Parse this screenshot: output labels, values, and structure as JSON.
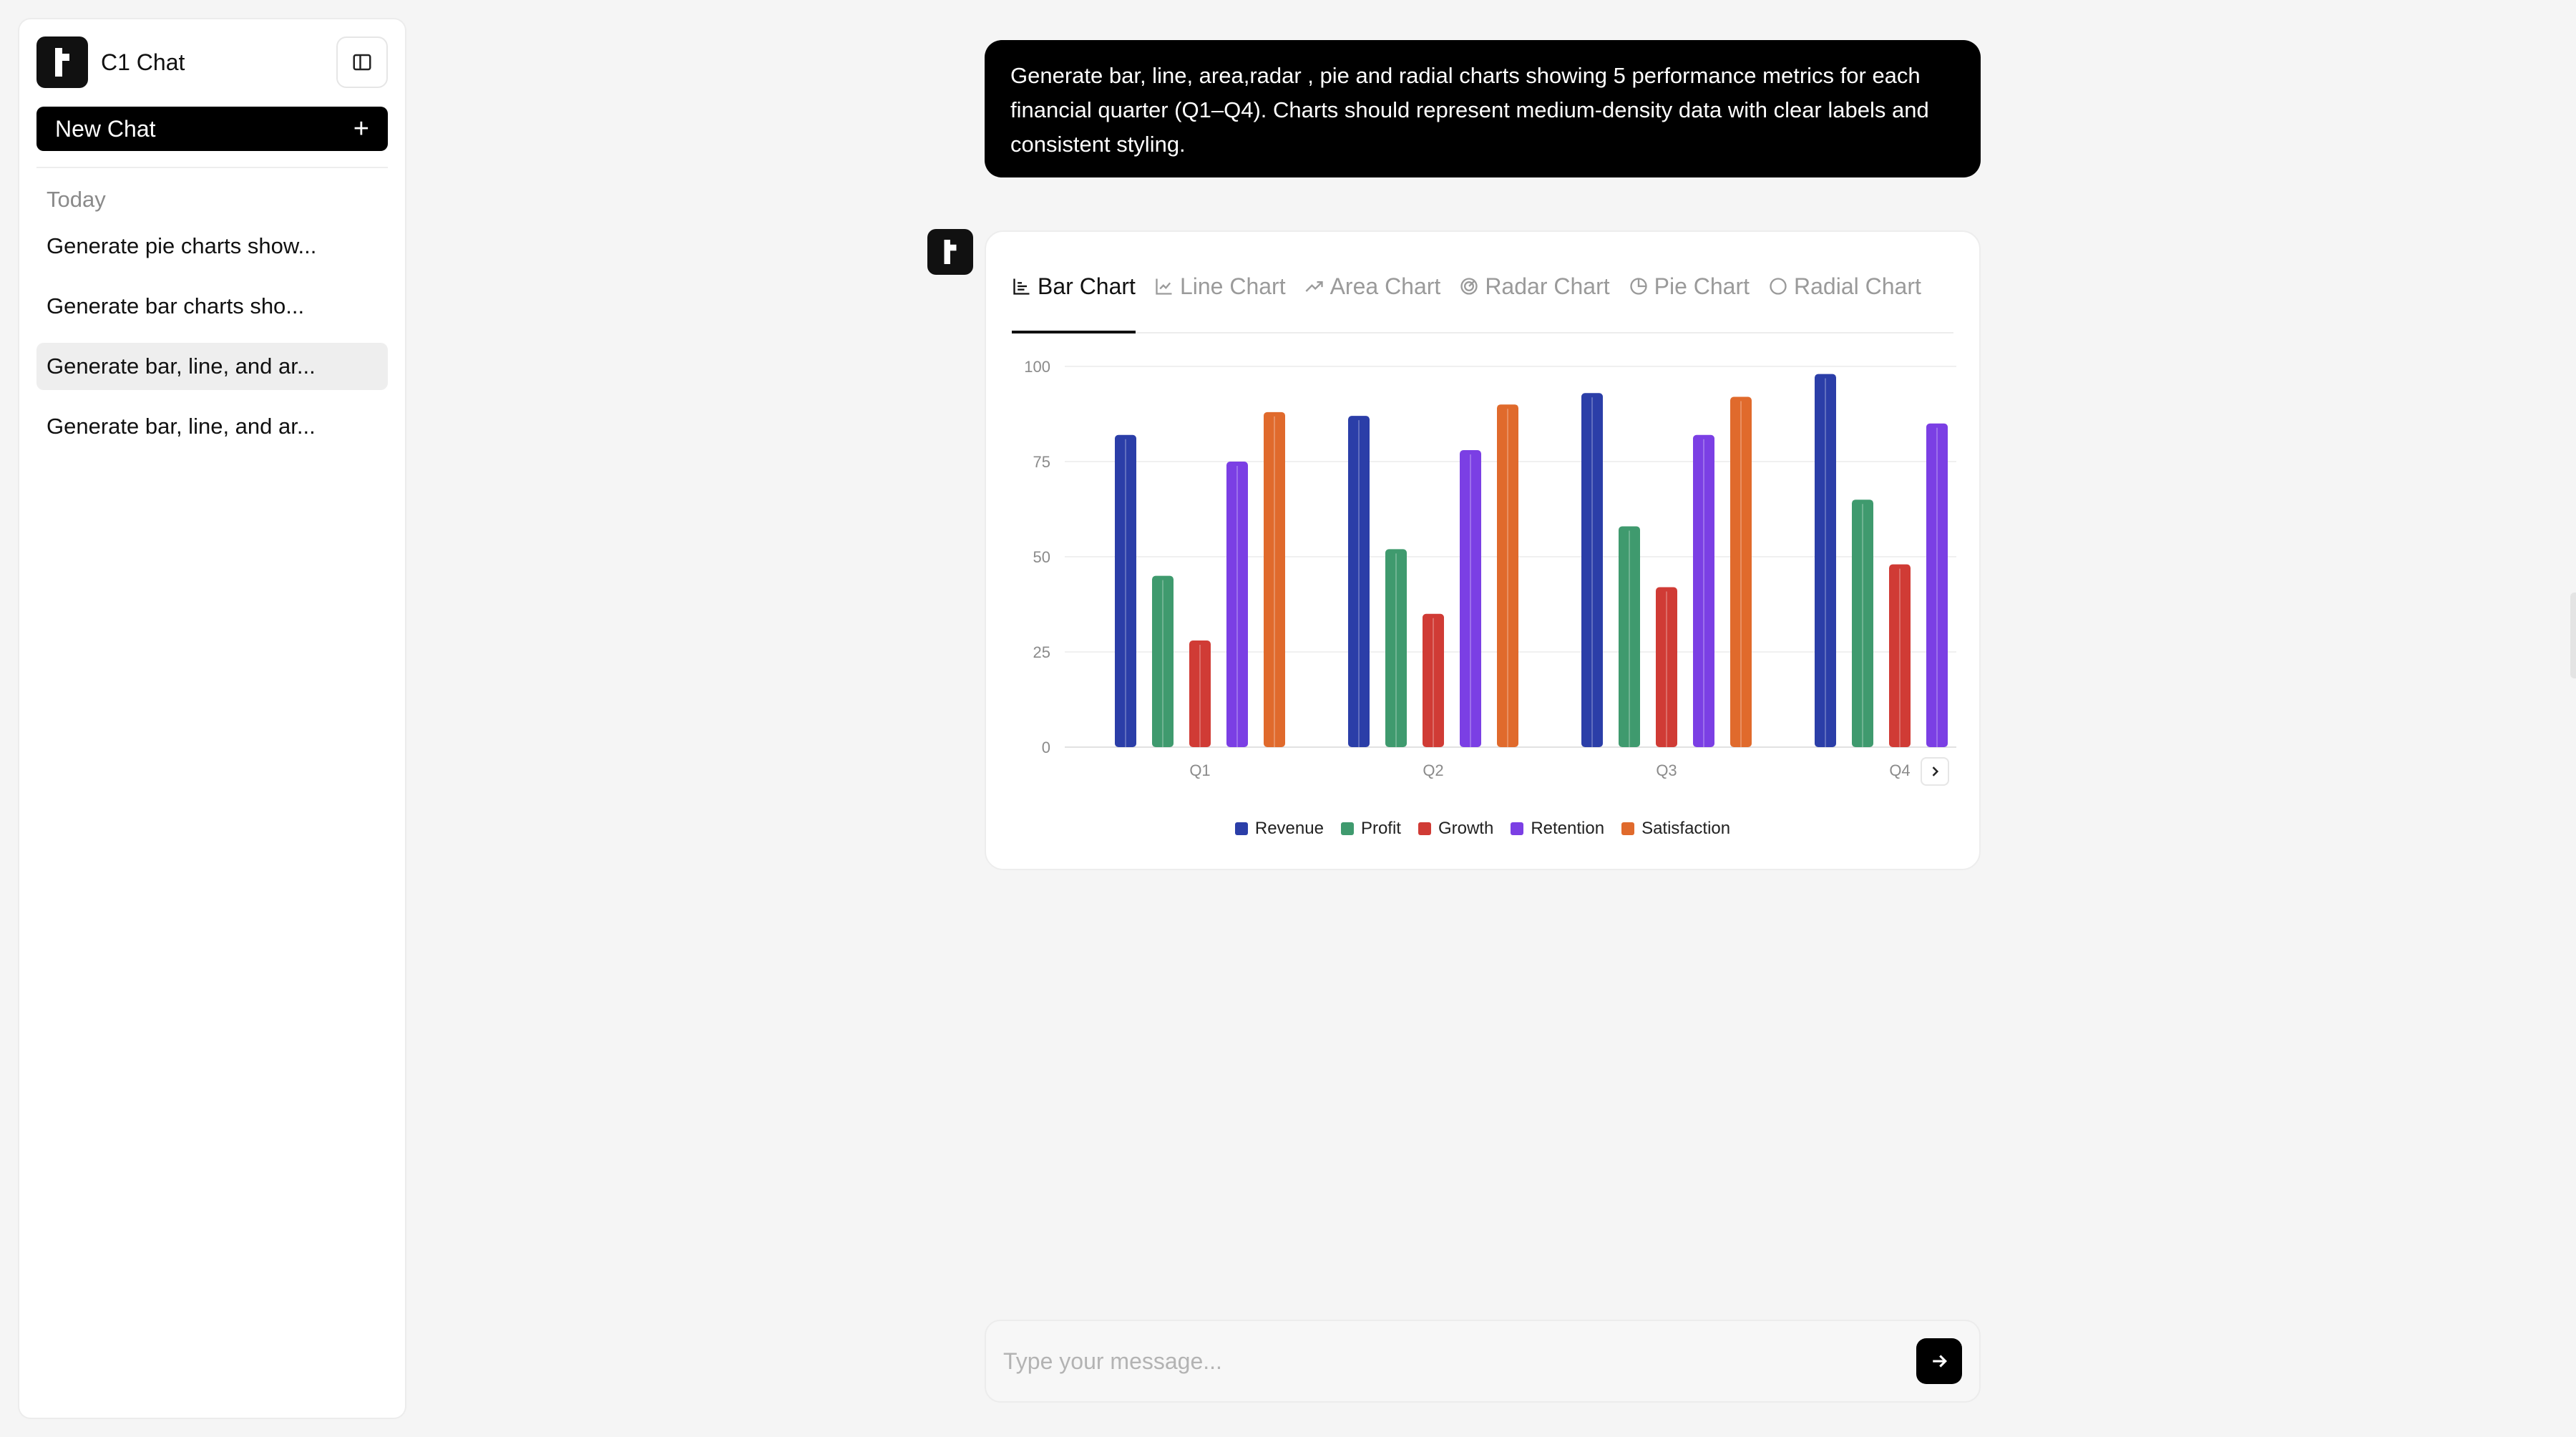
{
  "sidebar": {
    "app_title": "C1 Chat",
    "new_chat_label": "New Chat",
    "new_chat_icon": "+",
    "section_label": "Today",
    "history": [
      {
        "label": "Generate pie charts show...",
        "active": false
      },
      {
        "label": "Generate bar charts sho...",
        "active": false
      },
      {
        "label": "Generate bar, line, and ar...",
        "active": true
      },
      {
        "label": "Generate bar, line, and ar...",
        "active": false
      }
    ]
  },
  "conversation": {
    "user_message": "Generate bar, line, area,radar , pie and radial charts showing 5 performance metrics for each financial quarter (Q1–Q4). Charts should represent medium-density data with clear labels and consistent styling."
  },
  "tabs": [
    {
      "label": "Bar Chart",
      "icon": "bar-chart-icon",
      "active": true
    },
    {
      "label": "Line Chart",
      "icon": "line-chart-icon",
      "active": false
    },
    {
      "label": "Area Chart",
      "icon": "area-chart-icon",
      "active": false
    },
    {
      "label": "Radar Chart",
      "icon": "radar-chart-icon",
      "active": false
    },
    {
      "label": "Pie Chart",
      "icon": "pie-chart-icon",
      "active": false
    },
    {
      "label": "Radial Chart",
      "icon": "radial-chart-icon",
      "active": false
    }
  ],
  "chart_data": {
    "type": "bar",
    "categories": [
      "Q1",
      "Q2",
      "Q3",
      "Q4"
    ],
    "yticks": [
      0,
      25,
      50,
      75,
      100
    ],
    "ylim": [
      0,
      100
    ],
    "grid": true,
    "legend_position": "bottom",
    "series": [
      {
        "name": "Revenue",
        "color": "#2b3ea8",
        "values": [
          82,
          87,
          93,
          98
        ]
      },
      {
        "name": "Profit",
        "color": "#3f9a6e",
        "values": [
          45,
          52,
          58,
          65
        ]
      },
      {
        "name": "Growth",
        "color": "#d03b35",
        "values": [
          28,
          35,
          42,
          48
        ]
      },
      {
        "name": "Retention",
        "color": "#7b3fe4",
        "values": [
          75,
          78,
          82,
          85
        ]
      },
      {
        "name": "Satisfaction",
        "color": "#e06a2c",
        "values": [
          88,
          90,
          92,
          null
        ]
      }
    ]
  },
  "composer": {
    "placeholder": "Type your message..."
  }
}
